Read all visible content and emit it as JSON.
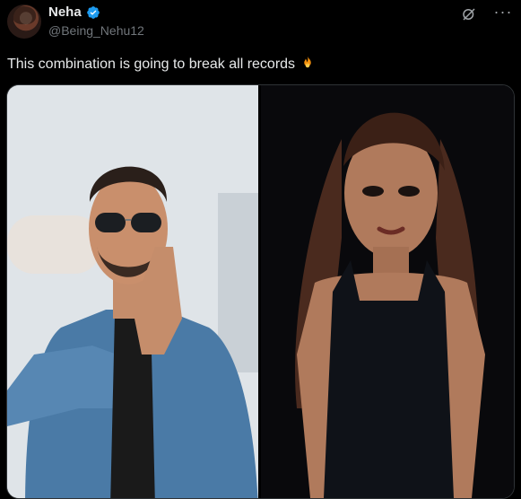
{
  "post": {
    "author_name": "Neha",
    "handle": "@Being_Nehu12",
    "text": "This combination is going to break all records"
  },
  "icons": {
    "verified": "verified-badge-icon",
    "grok": "grok-icon",
    "more": "more-options-icon",
    "fire": "fire-emoji-icon"
  },
  "colors": {
    "background": "#000000",
    "text_primary": "#e7e9ea",
    "text_secondary": "#71767b",
    "verified_blue": "#1d9bf0"
  },
  "media": {
    "images": [
      {
        "description": "man-in-denim-jacket-namaste"
      },
      {
        "description": "woman-in-black-dress"
      }
    ]
  }
}
